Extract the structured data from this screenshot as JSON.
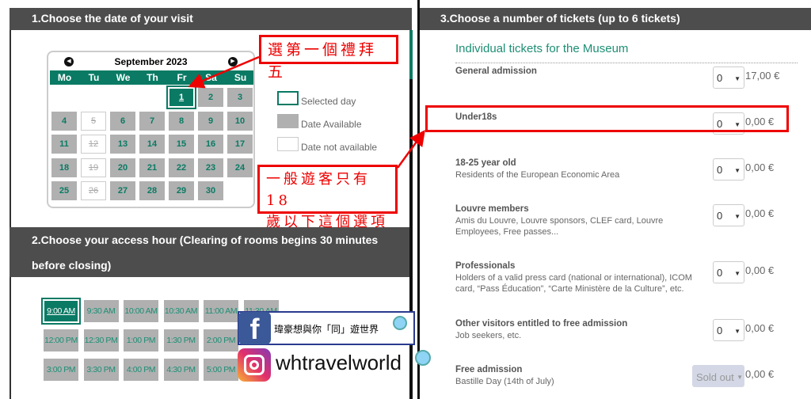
{
  "section1": {
    "title": "1.Choose the date of your visit",
    "calendar": {
      "month": "September 2023",
      "weekdays": [
        "Mo",
        "Tu",
        "We",
        "Th",
        "Fr",
        "Sa",
        "Su"
      ],
      "selected": 1,
      "unavailable": [
        5,
        12,
        19,
        26
      ],
      "days_in_month": 30,
      "first_weekday_index": 4
    },
    "legend": {
      "selected": "Selected day",
      "available": "Date Available",
      "not_available": "Date not available"
    }
  },
  "section2": {
    "title_line1": "2.Choose your access hour (Clearing of rooms begins 30 minutes",
    "title_line2": "before closing)",
    "times": [
      "9:00 AM",
      "9:30 AM",
      "10:00 AM",
      "10:30 AM",
      "11:00 AM",
      "11:30 AM",
      "12:00 PM",
      "12:30 PM",
      "1:00 PM",
      "1:30 PM",
      "2:00 PM",
      "",
      "3:00 PM",
      "3:30 PM",
      "4:00 PM",
      "4:30 PM",
      "5:00 PM",
      ""
    ],
    "selected_time": "9:00 AM"
  },
  "section3": {
    "title": "3.Choose a number of tickets (up to 6 tickets)",
    "subtitle": "Individual tickets for the Museum",
    "tickets": [
      {
        "name": "General admission",
        "desc": "",
        "qty": "0",
        "price": "17,00 €"
      },
      {
        "name": "Under18s",
        "desc": "",
        "qty": "0",
        "price": "0,00 €"
      },
      {
        "name": "18-25 year old",
        "desc": "Residents of the European Economic Area",
        "qty": "0",
        "price": "0,00 €"
      },
      {
        "name": "Louvre members",
        "desc": "Amis du Louvre, Louvre sponsors, CLEF card, Louvre Employees, Free passes...",
        "qty": "0",
        "price": "0,00 €"
      },
      {
        "name": "Professionals",
        "desc": "Holders of a valid press card (national or international), ICOM card, “Pass Éducation”, “Carte Ministère de la Culture”, etc.",
        "qty": "0",
        "price": "0,00 €"
      },
      {
        "name": "Other visitors entitled to free admission",
        "desc": "Job seekers, etc.",
        "qty": "0",
        "price": "0,00 €"
      },
      {
        "name": "Free admission",
        "desc": "Bastille Day (14th of July)",
        "qty": "Sold out",
        "price": "0,00 €"
      }
    ]
  },
  "annotations": {
    "note1": "選第一個禮拜五",
    "note2_line1": "一般遊客只有18",
    "note2_line2": "歲以下這個選項"
  },
  "watermark": {
    "facebook": "瑋豪想與你「同」遊世界",
    "instagram": "whtravelworld"
  },
  "colors": {
    "accent": "#0a7a64",
    "header": "#4d4d4d",
    "annotation": "#e00000"
  }
}
